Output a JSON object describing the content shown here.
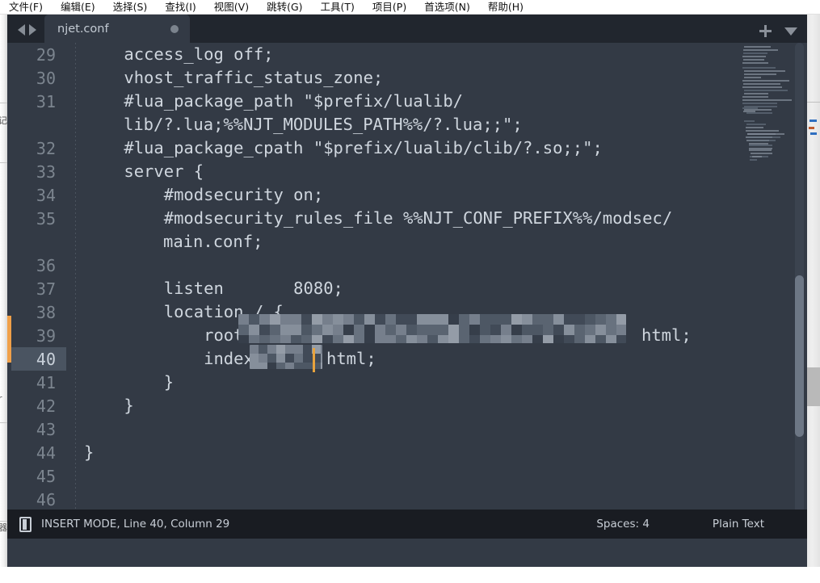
{
  "menubar": {
    "items": [
      {
        "label": "文件(F)"
      },
      {
        "label": "编辑(E)"
      },
      {
        "label": "选择(S)"
      },
      {
        "label": "查找(I)"
      },
      {
        "label": "视图(V)"
      },
      {
        "label": "跳转(G)"
      },
      {
        "label": "工具(T)"
      },
      {
        "label": "项目(P)"
      },
      {
        "label": "首选项(N)"
      },
      {
        "label": "帮助(H)"
      }
    ]
  },
  "tabbar": {
    "tabs": [
      {
        "label": "njet.conf",
        "dirty": true
      }
    ],
    "nav_prev_icon": "arrow-left-icon",
    "nav_next_icon": "arrow-right-icon",
    "new_tab_icon": "plus-icon",
    "tab_menu_icon": "chevron-down-icon"
  },
  "editor": {
    "theme_bg": "#333a45",
    "gutter_fg": "#7c858f",
    "text_fg": "#cfd6de",
    "active_line_bg": "#4a5461",
    "change_marker_color": "#f0a049",
    "cursor_color": "#e8a33d",
    "active_line": 40,
    "lines": [
      {
        "number": "29",
        "text": "    access_log off;",
        "wrap": null
      },
      {
        "number": "30",
        "text": "    vhost_traffic_status_zone;",
        "wrap": null
      },
      {
        "number": "31",
        "text": "    #lua_package_path \"$prefix/lualib/",
        "wrap": "lib/?.lua;%%NJT_MODULES_PATH%%/?.lua;;\";"
      },
      {
        "number": "32",
        "text": "    #lua_package_cpath \"$prefix/lualib/clib/?.so;;\";",
        "wrap": null
      },
      {
        "number": "33",
        "text": "    server {",
        "wrap": null
      },
      {
        "number": "34",
        "text": "        #modsecurity on;",
        "wrap": null
      },
      {
        "number": "35",
        "text": "        #modsecurity_rules_file %%NJT_CONF_PREFIX%%/modsec/",
        "wrap": "main.conf;"
      },
      {
        "number": "36",
        "text": "",
        "wrap": null
      },
      {
        "number": "37",
        "text": "        listen       8080;",
        "wrap": null
      },
      {
        "number": "38",
        "text": "        location / {",
        "wrap": null
      },
      {
        "number": "39",
        "text": "            root D:",
        "redacted": true,
        "tail": "html;",
        "wrap": null
      },
      {
        "number": "40",
        "text": "            index ind",
        "redacted": true,
        "tail": "html;",
        "wrap": null
      },
      {
        "number": "41",
        "text": "        }",
        "wrap": null
      },
      {
        "number": "42",
        "text": "    }",
        "wrap": null
      },
      {
        "number": "43",
        "text": "",
        "wrap": null
      },
      {
        "number": "44",
        "text": "}",
        "wrap": null
      },
      {
        "number": "45",
        "text": "",
        "wrap": null
      },
      {
        "number": "46",
        "text": "",
        "wrap": null
      }
    ]
  },
  "statusbar": {
    "mode_icon": "cursor-mode-icon",
    "left_text": "INSERT MODE, Line 40, Column 29",
    "indentation": "Spaces: 4",
    "language": "Plain Text"
  }
}
